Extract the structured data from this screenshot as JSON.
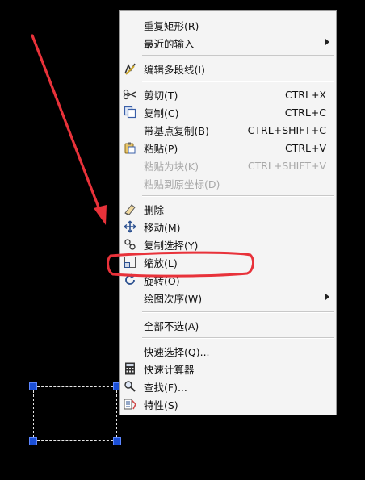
{
  "menu": {
    "items": [
      {
        "label": "重复矩形(R)",
        "shortcut": "",
        "icon": "",
        "disabled": false,
        "submenu": false
      },
      {
        "label": "最近的输入",
        "shortcut": "",
        "icon": "",
        "disabled": false,
        "submenu": true
      },
      {
        "label": "编辑多段线(I)",
        "shortcut": "",
        "icon": "edit-polyline-icon",
        "disabled": false,
        "submenu": false
      },
      {
        "label": "剪切(T)",
        "shortcut": "CTRL+X",
        "icon": "scissors-icon",
        "disabled": false,
        "submenu": false
      },
      {
        "label": "复制(C)",
        "shortcut": "CTRL+C",
        "icon": "copy-icon",
        "disabled": false,
        "submenu": false
      },
      {
        "label": "带基点复制(B)",
        "shortcut": "CTRL+SHIFT+C",
        "icon": "",
        "disabled": false,
        "submenu": false
      },
      {
        "label": "粘贴(P)",
        "shortcut": "CTRL+V",
        "icon": "paste-icon",
        "disabled": false,
        "submenu": false
      },
      {
        "label": "粘贴为块(K)",
        "shortcut": "CTRL+SHIFT+V",
        "icon": "",
        "disabled": true,
        "submenu": false
      },
      {
        "label": "粘贴到原坐标(D)",
        "shortcut": "",
        "icon": "",
        "disabled": true,
        "submenu": false
      },
      {
        "label": "删除",
        "shortcut": "",
        "icon": "eraser-icon",
        "disabled": false,
        "submenu": false
      },
      {
        "label": "移动(M)",
        "shortcut": "",
        "icon": "move-icon",
        "disabled": false,
        "submenu": false
      },
      {
        "label": "复制选择(Y)",
        "shortcut": "",
        "icon": "copy-selection-icon",
        "disabled": false,
        "submenu": false
      },
      {
        "label": "缩放(L)",
        "shortcut": "",
        "icon": "scale-icon",
        "disabled": false,
        "submenu": false
      },
      {
        "label": "旋转(O)",
        "shortcut": "",
        "icon": "rotate-icon",
        "disabled": false,
        "submenu": false
      },
      {
        "label": "绘图次序(W)",
        "shortcut": "",
        "icon": "",
        "disabled": false,
        "submenu": true
      },
      {
        "label": "全部不选(A)",
        "shortcut": "",
        "icon": "",
        "disabled": false,
        "submenu": false
      },
      {
        "label": "快速选择(Q)...",
        "shortcut": "",
        "icon": "",
        "disabled": false,
        "submenu": false
      },
      {
        "label": "快速计算器",
        "shortcut": "",
        "icon": "calculator-icon",
        "disabled": false,
        "submenu": false
      },
      {
        "label": "查找(F)...",
        "shortcut": "",
        "icon": "find-icon",
        "disabled": false,
        "submenu": false
      },
      {
        "label": "特性(S)",
        "shortcut": "",
        "icon": "properties-icon",
        "disabled": false,
        "submenu": false
      }
    ]
  },
  "colors": {
    "annotation": "#e8323a",
    "grip": "#1b4fd6",
    "menu_bg": "#f4f4f4"
  }
}
